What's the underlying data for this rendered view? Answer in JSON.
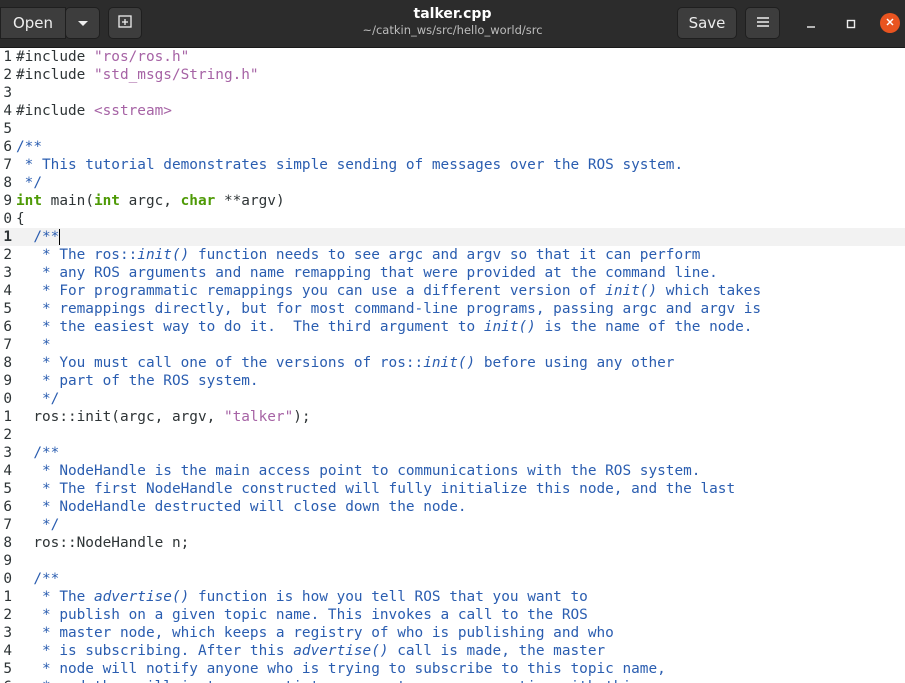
{
  "header": {
    "open_label": "Open",
    "title": "talker.cpp",
    "subtitle": "~/catkin_ws/src/hello_world/src",
    "save_label": "Save"
  },
  "icons": {
    "open_dropdown": "chevron-down-icon",
    "new_tab": "new-tab-icon",
    "menu": "hamburger-menu-icon",
    "minimize": "minimize-icon",
    "maximize": "maximize-icon",
    "close": "close-icon"
  },
  "colors": {
    "header_bg": "#2c2c2c",
    "close_button": "#e95420",
    "comment": "#2a5db0",
    "string": "#a663a5",
    "keyword": "#4e9a06"
  },
  "editor": {
    "lines": [
      {
        "n": "1",
        "segs": [
          {
            "t": "#include ",
            "c": "pp"
          },
          {
            "t": "\"ros/ros.h\"",
            "c": "str"
          }
        ]
      },
      {
        "n": "2",
        "segs": [
          {
            "t": "#include ",
            "c": "pp"
          },
          {
            "t": "\"std_msgs/String.h\"",
            "c": "str"
          }
        ]
      },
      {
        "n": "3",
        "segs": []
      },
      {
        "n": "4",
        "segs": [
          {
            "t": "#include ",
            "c": "pp"
          },
          {
            "t": "<sstream>",
            "c": "str"
          }
        ]
      },
      {
        "n": "5",
        "segs": []
      },
      {
        "n": "6",
        "segs": [
          {
            "t": "/**",
            "c": "cm"
          }
        ]
      },
      {
        "n": "7",
        "segs": [
          {
            "t": " * This tutorial demonstrates simple sending of messages over the ROS system.",
            "c": "cm"
          }
        ]
      },
      {
        "n": "8",
        "segs": [
          {
            "t": " */",
            "c": "cm"
          }
        ]
      },
      {
        "n": "9",
        "segs": [
          {
            "t": "int",
            "c": "ty"
          },
          {
            "t": " main(",
            "c": ""
          },
          {
            "t": "int",
            "c": "ty"
          },
          {
            "t": " argc, ",
            "c": ""
          },
          {
            "t": "char",
            "c": "ty"
          },
          {
            "t": " **argv)",
            "c": ""
          }
        ]
      },
      {
        "n": "0",
        "segs": [
          {
            "t": "{",
            "c": ""
          }
        ]
      },
      {
        "n": "1",
        "cur": true,
        "segs": [
          {
            "t": "  /**",
            "c": "cm"
          }
        ]
      },
      {
        "n": "2",
        "segs": [
          {
            "t": "   * The ros::",
            "c": "cm"
          },
          {
            "t": "init()",
            "c": "cm it"
          },
          {
            "t": " function needs to see argc and argv so that it can perform",
            "c": "cm"
          }
        ]
      },
      {
        "n": "3",
        "segs": [
          {
            "t": "   * any ROS arguments and name remapping that were provided at the command line.",
            "c": "cm"
          }
        ]
      },
      {
        "n": "4",
        "segs": [
          {
            "t": "   * For programmatic remappings you can use a different version of ",
            "c": "cm"
          },
          {
            "t": "init()",
            "c": "cm it"
          },
          {
            "t": " which takes",
            "c": "cm"
          }
        ]
      },
      {
        "n": "5",
        "segs": [
          {
            "t": "   * remappings directly, but for most command-line programs, passing argc and argv is",
            "c": "cm"
          }
        ]
      },
      {
        "n": "6",
        "segs": [
          {
            "t": "   * the easiest way to do it.  The third argument to ",
            "c": "cm"
          },
          {
            "t": "init()",
            "c": "cm it"
          },
          {
            "t": " is the name of the node.",
            "c": "cm"
          }
        ]
      },
      {
        "n": "7",
        "segs": [
          {
            "t": "   *",
            "c": "cm"
          }
        ]
      },
      {
        "n": "8",
        "segs": [
          {
            "t": "   * You must call one of the versions of ros::",
            "c": "cm"
          },
          {
            "t": "init()",
            "c": "cm it"
          },
          {
            "t": " before using any other",
            "c": "cm"
          }
        ]
      },
      {
        "n": "9",
        "segs": [
          {
            "t": "   * part of the ROS system.",
            "c": "cm"
          }
        ]
      },
      {
        "n": "0",
        "segs": [
          {
            "t": "   */",
            "c": "cm"
          }
        ]
      },
      {
        "n": "1",
        "segs": [
          {
            "t": "  ros::init(argc, argv, ",
            "c": ""
          },
          {
            "t": "\"talker\"",
            "c": "str"
          },
          {
            "t": ");",
            "c": ""
          }
        ]
      },
      {
        "n": "2",
        "segs": []
      },
      {
        "n": "3",
        "segs": [
          {
            "t": "  /**",
            "c": "cm"
          }
        ]
      },
      {
        "n": "4",
        "segs": [
          {
            "t": "   * NodeHandle is the main access point to communications with the ROS system.",
            "c": "cm"
          }
        ]
      },
      {
        "n": "5",
        "segs": [
          {
            "t": "   * The first NodeHandle constructed will fully initialize this node, and the last",
            "c": "cm"
          }
        ]
      },
      {
        "n": "6",
        "segs": [
          {
            "t": "   * NodeHandle destructed will close down the node.",
            "c": "cm"
          }
        ]
      },
      {
        "n": "7",
        "segs": [
          {
            "t": "   */",
            "c": "cm"
          }
        ]
      },
      {
        "n": "8",
        "segs": [
          {
            "t": "  ros::NodeHandle n;",
            "c": ""
          }
        ]
      },
      {
        "n": "9",
        "segs": []
      },
      {
        "n": "0",
        "segs": [
          {
            "t": "  /**",
            "c": "cm"
          }
        ]
      },
      {
        "n": "1",
        "segs": [
          {
            "t": "   * The ",
            "c": "cm"
          },
          {
            "t": "advertise()",
            "c": "cm it"
          },
          {
            "t": " function is how you tell ROS that you want to",
            "c": "cm"
          }
        ]
      },
      {
        "n": "2",
        "segs": [
          {
            "t": "   * publish on a given topic name. This invokes a call to the ROS",
            "c": "cm"
          }
        ]
      },
      {
        "n": "3",
        "segs": [
          {
            "t": "   * master node, which keeps a registry of who is publishing and who",
            "c": "cm"
          }
        ]
      },
      {
        "n": "4",
        "segs": [
          {
            "t": "   * is subscribing. After this ",
            "c": "cm"
          },
          {
            "t": "advertise()",
            "c": "cm it"
          },
          {
            "t": " call is made, the master",
            "c": "cm"
          }
        ]
      },
      {
        "n": "5",
        "segs": [
          {
            "t": "   * node will notify anyone who is trying to subscribe to this topic name,",
            "c": "cm"
          }
        ]
      },
      {
        "n": "6",
        "segs": [
          {
            "t": "   * and they will in turn negotiate a peer-to-peer connection with this",
            "c": "cm"
          }
        ]
      }
    ]
  }
}
